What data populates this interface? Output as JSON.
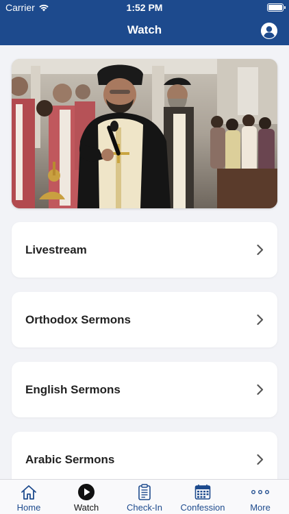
{
  "status_bar": {
    "carrier": "Carrier",
    "time": "1:52 PM"
  },
  "header": {
    "title": "Watch"
  },
  "icons": {
    "profile": "person-circle-icon",
    "wifi": "wifi-icon",
    "battery": "battery-icon",
    "chevron": "chevron-right-icon"
  },
  "colors": {
    "header_bg": "#1d4a8d",
    "accent": "#1d4a8d",
    "background": "#f2f3f7"
  },
  "menu": {
    "items": [
      {
        "label": "Livestream"
      },
      {
        "label": "Orthodox Sermons"
      },
      {
        "label": "English Sermons"
      },
      {
        "label": "Arabic Sermons"
      }
    ]
  },
  "tabbar": {
    "active": "Watch",
    "tabs": [
      {
        "label": "Home",
        "icon": "house-icon"
      },
      {
        "label": "Watch",
        "icon": "play-circle-icon"
      },
      {
        "label": "Check-In",
        "icon": "clipboard-icon"
      },
      {
        "label": "Confession",
        "icon": "calendar-icon"
      },
      {
        "label": "More",
        "icon": "more-dots-icon"
      }
    ]
  }
}
